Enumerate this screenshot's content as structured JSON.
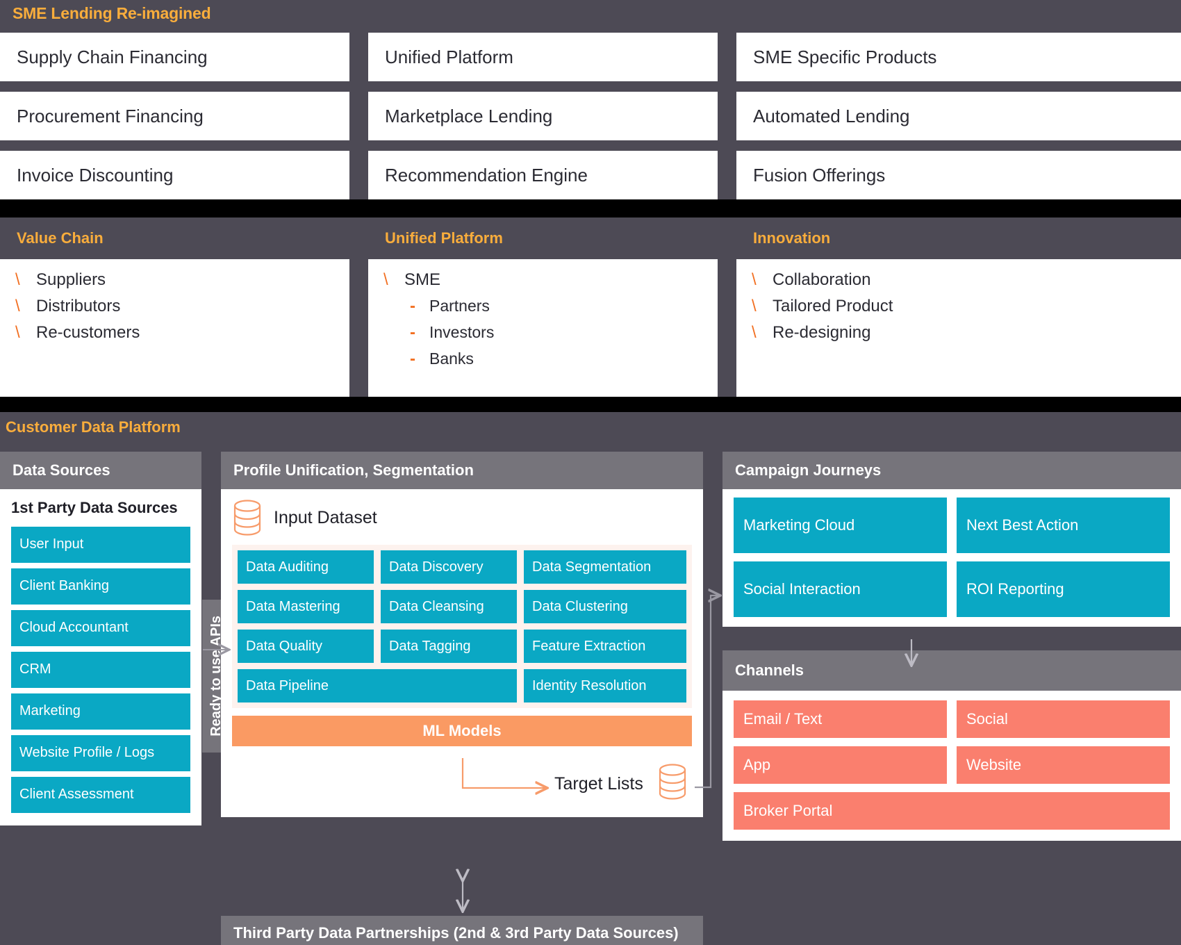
{
  "section1": {
    "title": "SME Lending Re-imagined",
    "columns": [
      [
        "Supply Chain Financing",
        "Procurement Financing",
        "Invoice Discounting"
      ],
      [
        "Unified Platform",
        "Marketplace Lending",
        "Recommendation Engine"
      ],
      [
        "SME Specific Products",
        "Automated Lending",
        "Fusion Offerings"
      ]
    ]
  },
  "section2": {
    "panels": [
      {
        "title": "Value Chain",
        "items": [
          {
            "marker": "\\",
            "label": "Suppliers"
          },
          {
            "marker": "\\",
            "label": "Distributors"
          },
          {
            "marker": "\\",
            "label": "Re-customers"
          }
        ]
      },
      {
        "title": "Unified Platform",
        "items": [
          {
            "marker": "\\",
            "label": "SME"
          }
        ],
        "subitems": [
          {
            "marker": "-",
            "label": "Partners"
          },
          {
            "marker": "-",
            "label": "Investors"
          },
          {
            "marker": "-",
            "label": "Banks"
          }
        ]
      },
      {
        "title": "Innovation",
        "items": [
          {
            "marker": "\\",
            "label": "Collaboration"
          },
          {
            "marker": "\\",
            "label": "Tailored Product"
          },
          {
            "marker": "\\",
            "label": "Re-designing"
          }
        ]
      }
    ]
  },
  "section3": {
    "title": "Customer Data Platform",
    "data_sources": {
      "heading": "Data Sources",
      "subheading": "1st Party Data Sources",
      "items": [
        "User Input",
        "Client Banking",
        "Cloud Accountant",
        "CRM",
        "Marketing",
        "Website Profile / Logs",
        "Client Assessment"
      ]
    },
    "apis_tab": "Ready to use APIs",
    "profile_unification": {
      "heading": "Profile Unification, Segmentation",
      "input_dataset": "Input Dataset",
      "grid": [
        [
          "Data Auditing",
          "Data Discovery",
          "Data Segmentation"
        ],
        [
          "Data Mastering",
          "Data Cleansing",
          "Data Clustering"
        ],
        [
          "Data Quality",
          "Data Tagging",
          "Feature Extraction"
        ]
      ],
      "wide_row": {
        "left": "Data Pipeline",
        "right": "Identity Resolution"
      },
      "ml_models": "ML Models",
      "target_lists": "Target Lists"
    },
    "third_party": "Third Party Data Partnerships (2nd & 3rd Party Data Sources)",
    "campaign_journeys": {
      "heading": "Campaign Journeys",
      "rows": [
        [
          "Marketing Cloud",
          "Next Best Action"
        ],
        [
          "Social Interaction",
          "ROI Reporting"
        ]
      ]
    },
    "channels": {
      "heading": "Channels",
      "rows": [
        [
          "Email / Text",
          "Social"
        ],
        [
          "App",
          "Website"
        ]
      ],
      "wide": "Broker Portal"
    }
  },
  "colors": {
    "dark_slate": "#4d4a55",
    "gray_header": "#76747b",
    "amber": "#f9ad3c",
    "orange": "#f26f21",
    "teal": "#0aa8c4",
    "salmon": "#fa7f6e",
    "peach": "#fa9a63",
    "pink_tint": "#fdf2ee",
    "black_band": "#000000"
  }
}
